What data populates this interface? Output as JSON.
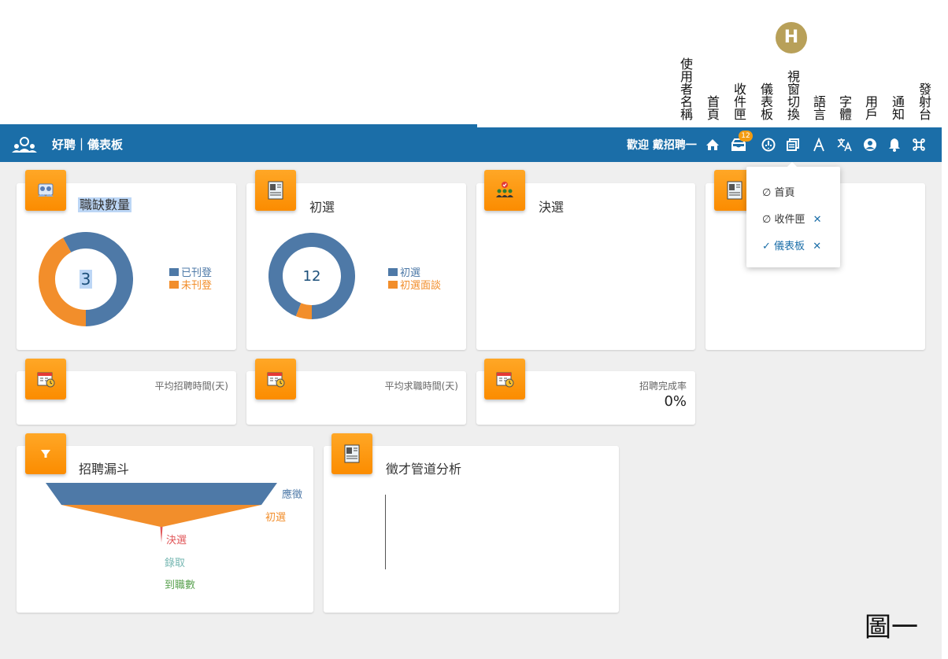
{
  "annotations": {
    "labels": [
      {
        "text": "使用者名稱",
        "col": 0
      },
      {
        "text": "首頁",
        "col": 1
      },
      {
        "text": "收件匣",
        "col": 2
      },
      {
        "text": "儀表板",
        "col": 3
      },
      {
        "text": "視窗切換",
        "col": 4
      },
      {
        "text": "語言",
        "col": 5
      },
      {
        "text": "字體",
        "col": 6
      },
      {
        "text": "用戶",
        "col": 7
      },
      {
        "text": "通知",
        "col": 8
      },
      {
        "text": "發射台",
        "col": 9
      }
    ],
    "badge_letter": "H",
    "figure_label": "圖一"
  },
  "navbar": {
    "title": "好聘｜儀表板",
    "welcome": "歡迎 戴招聘一",
    "inbox_badge": "12",
    "icons": [
      "home-icon",
      "inbox-icon",
      "dashboard-icon",
      "window-switch-icon",
      "font-icon",
      "language-icon",
      "user-icon",
      "bell-icon",
      "command-icon"
    ]
  },
  "dropdown": {
    "items": [
      {
        "label": "首頁",
        "closable": false,
        "active": false
      },
      {
        "label": "收件匣",
        "closable": true,
        "active": false
      },
      {
        "label": "儀表板",
        "closable": true,
        "active": true
      }
    ],
    "close_symbol": "✕"
  },
  "cards": {
    "vacancies": {
      "title": "職缺數量",
      "center_value": "3",
      "legend": [
        "已刊登",
        "未刊登"
      ]
    },
    "screening": {
      "title": "初選",
      "center_value": "12",
      "legend": [
        "初選",
        "初選面談"
      ]
    },
    "final": {
      "title": "決選"
    },
    "avg_hire_time": {
      "title": "平均招聘時間(天)"
    },
    "avg_job_search_time": {
      "title": "平均求職時間(天)"
    },
    "completion_rate": {
      "title": "招聘完成率",
      "value": "0%"
    },
    "funnel": {
      "title": "招聘漏斗"
    },
    "channel": {
      "title": "徵才管道分析"
    }
  },
  "colors": {
    "navbar": "#1b6ea8",
    "series_blue": "#4e79a7",
    "series_orange": "#f28e2b",
    "icon_orange": "#fb8c00",
    "funnel_red": "#e15759",
    "funnel_teal": "#76b7b2",
    "funnel_green": "#59a14f"
  },
  "chart_data": [
    {
      "type": "pie",
      "title": "職缺數量",
      "categories": [
        "已刊登",
        "未刊登"
      ],
      "values": [
        0.58,
        0.42
      ],
      "colors": [
        "#4e79a7",
        "#f28e2b"
      ]
    },
    {
      "type": "pie",
      "title": "初選",
      "categories": [
        "初選",
        "初選面談"
      ],
      "values": [
        0.94,
        0.06
      ],
      "colors": [
        "#4e79a7",
        "#f28e2b"
      ]
    },
    {
      "type": "bar",
      "title": "招聘漏斗",
      "categories": [
        "應徵",
        "初選",
        "決選",
        "錄取",
        "到職數"
      ],
      "values": [
        100,
        100,
        0,
        0,
        0
      ],
      "colors": [
        "#4e79a7",
        "#f28e2b",
        "#e15759",
        "#76b7b2",
        "#59a14f"
      ]
    }
  ]
}
